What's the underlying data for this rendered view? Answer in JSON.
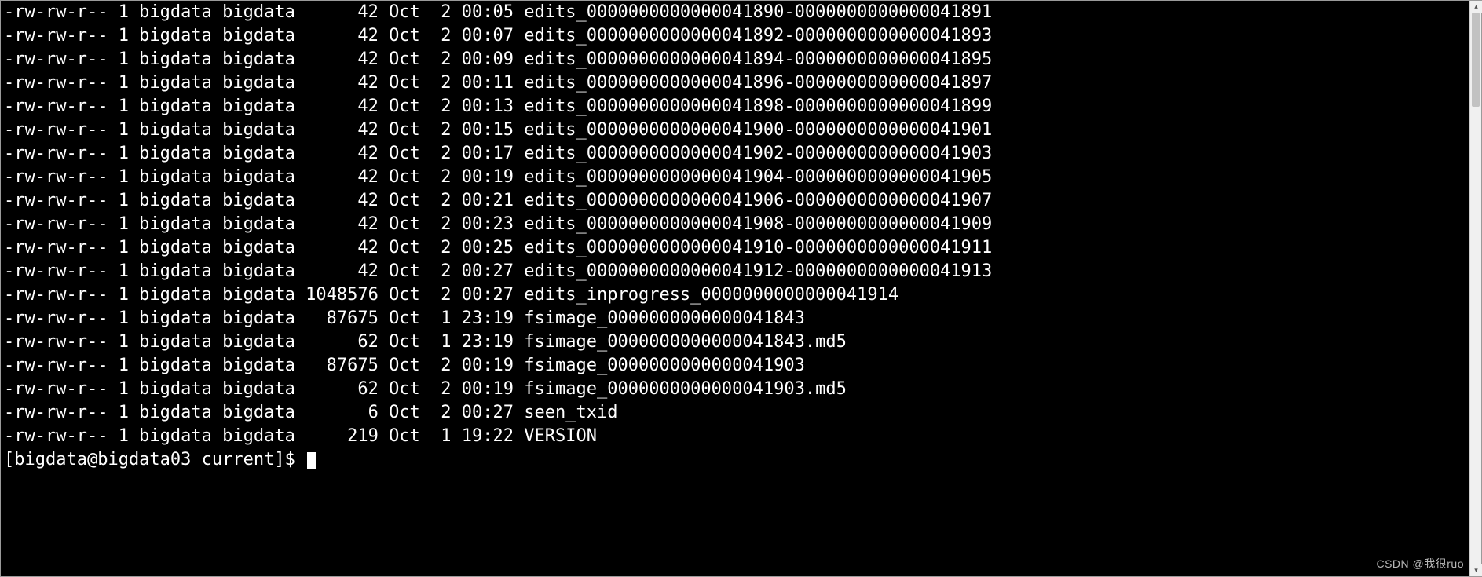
{
  "watermark": "CSDN @我很ruo",
  "prompt": "[bigdata@bigdata03 current]$ ",
  "rows": [
    {
      "perm": "-rw-rw-r--",
      "links": "1",
      "owner": "bigdata",
      "group": "bigdata",
      "size": "42",
      "month": "Oct",
      "day": "2",
      "time": "00:05",
      "name": "edits_0000000000000041890-0000000000000041891"
    },
    {
      "perm": "-rw-rw-r--",
      "links": "1",
      "owner": "bigdata",
      "group": "bigdata",
      "size": "42",
      "month": "Oct",
      "day": "2",
      "time": "00:07",
      "name": "edits_0000000000000041892-0000000000000041893"
    },
    {
      "perm": "-rw-rw-r--",
      "links": "1",
      "owner": "bigdata",
      "group": "bigdata",
      "size": "42",
      "month": "Oct",
      "day": "2",
      "time": "00:09",
      "name": "edits_0000000000000041894-0000000000000041895"
    },
    {
      "perm": "-rw-rw-r--",
      "links": "1",
      "owner": "bigdata",
      "group": "bigdata",
      "size": "42",
      "month": "Oct",
      "day": "2",
      "time": "00:11",
      "name": "edits_0000000000000041896-0000000000000041897"
    },
    {
      "perm": "-rw-rw-r--",
      "links": "1",
      "owner": "bigdata",
      "group": "bigdata",
      "size": "42",
      "month": "Oct",
      "day": "2",
      "time": "00:13",
      "name": "edits_0000000000000041898-0000000000000041899"
    },
    {
      "perm": "-rw-rw-r--",
      "links": "1",
      "owner": "bigdata",
      "group": "bigdata",
      "size": "42",
      "month": "Oct",
      "day": "2",
      "time": "00:15",
      "name": "edits_0000000000000041900-0000000000000041901"
    },
    {
      "perm": "-rw-rw-r--",
      "links": "1",
      "owner": "bigdata",
      "group": "bigdata",
      "size": "42",
      "month": "Oct",
      "day": "2",
      "time": "00:17",
      "name": "edits_0000000000000041902-0000000000000041903"
    },
    {
      "perm": "-rw-rw-r--",
      "links": "1",
      "owner": "bigdata",
      "group": "bigdata",
      "size": "42",
      "month": "Oct",
      "day": "2",
      "time": "00:19",
      "name": "edits_0000000000000041904-0000000000000041905"
    },
    {
      "perm": "-rw-rw-r--",
      "links": "1",
      "owner": "bigdata",
      "group": "bigdata",
      "size": "42",
      "month": "Oct",
      "day": "2",
      "time": "00:21",
      "name": "edits_0000000000000041906-0000000000000041907"
    },
    {
      "perm": "-rw-rw-r--",
      "links": "1",
      "owner": "bigdata",
      "group": "bigdata",
      "size": "42",
      "month": "Oct",
      "day": "2",
      "time": "00:23",
      "name": "edits_0000000000000041908-0000000000000041909"
    },
    {
      "perm": "-rw-rw-r--",
      "links": "1",
      "owner": "bigdata",
      "group": "bigdata",
      "size": "42",
      "month": "Oct",
      "day": "2",
      "time": "00:25",
      "name": "edits_0000000000000041910-0000000000000041911"
    },
    {
      "perm": "-rw-rw-r--",
      "links": "1",
      "owner": "bigdata",
      "group": "bigdata",
      "size": "42",
      "month": "Oct",
      "day": "2",
      "time": "00:27",
      "name": "edits_0000000000000041912-0000000000000041913"
    },
    {
      "perm": "-rw-rw-r--",
      "links": "1",
      "owner": "bigdata",
      "group": "bigdata",
      "size": "1048576",
      "month": "Oct",
      "day": "2",
      "time": "00:27",
      "name": "edits_inprogress_0000000000000041914"
    },
    {
      "perm": "-rw-rw-r--",
      "links": "1",
      "owner": "bigdata",
      "group": "bigdata",
      "size": "87675",
      "month": "Oct",
      "day": "1",
      "time": "23:19",
      "name": "fsimage_0000000000000041843"
    },
    {
      "perm": "-rw-rw-r--",
      "links": "1",
      "owner": "bigdata",
      "group": "bigdata",
      "size": "62",
      "month": "Oct",
      "day": "1",
      "time": "23:19",
      "name": "fsimage_0000000000000041843.md5"
    },
    {
      "perm": "-rw-rw-r--",
      "links": "1",
      "owner": "bigdata",
      "group": "bigdata",
      "size": "87675",
      "month": "Oct",
      "day": "2",
      "time": "00:19",
      "name": "fsimage_0000000000000041903"
    },
    {
      "perm": "-rw-rw-r--",
      "links": "1",
      "owner": "bigdata",
      "group": "bigdata",
      "size": "62",
      "month": "Oct",
      "day": "2",
      "time": "00:19",
      "name": "fsimage_0000000000000041903.md5"
    },
    {
      "perm": "-rw-rw-r--",
      "links": "1",
      "owner": "bigdata",
      "group": "bigdata",
      "size": "6",
      "month": "Oct",
      "day": "2",
      "time": "00:27",
      "name": "seen_txid"
    },
    {
      "perm": "-rw-rw-r--",
      "links": "1",
      "owner": "bigdata",
      "group": "bigdata",
      "size": "219",
      "month": "Oct",
      "day": "1",
      "time": "19:22",
      "name": "VERSION"
    }
  ]
}
